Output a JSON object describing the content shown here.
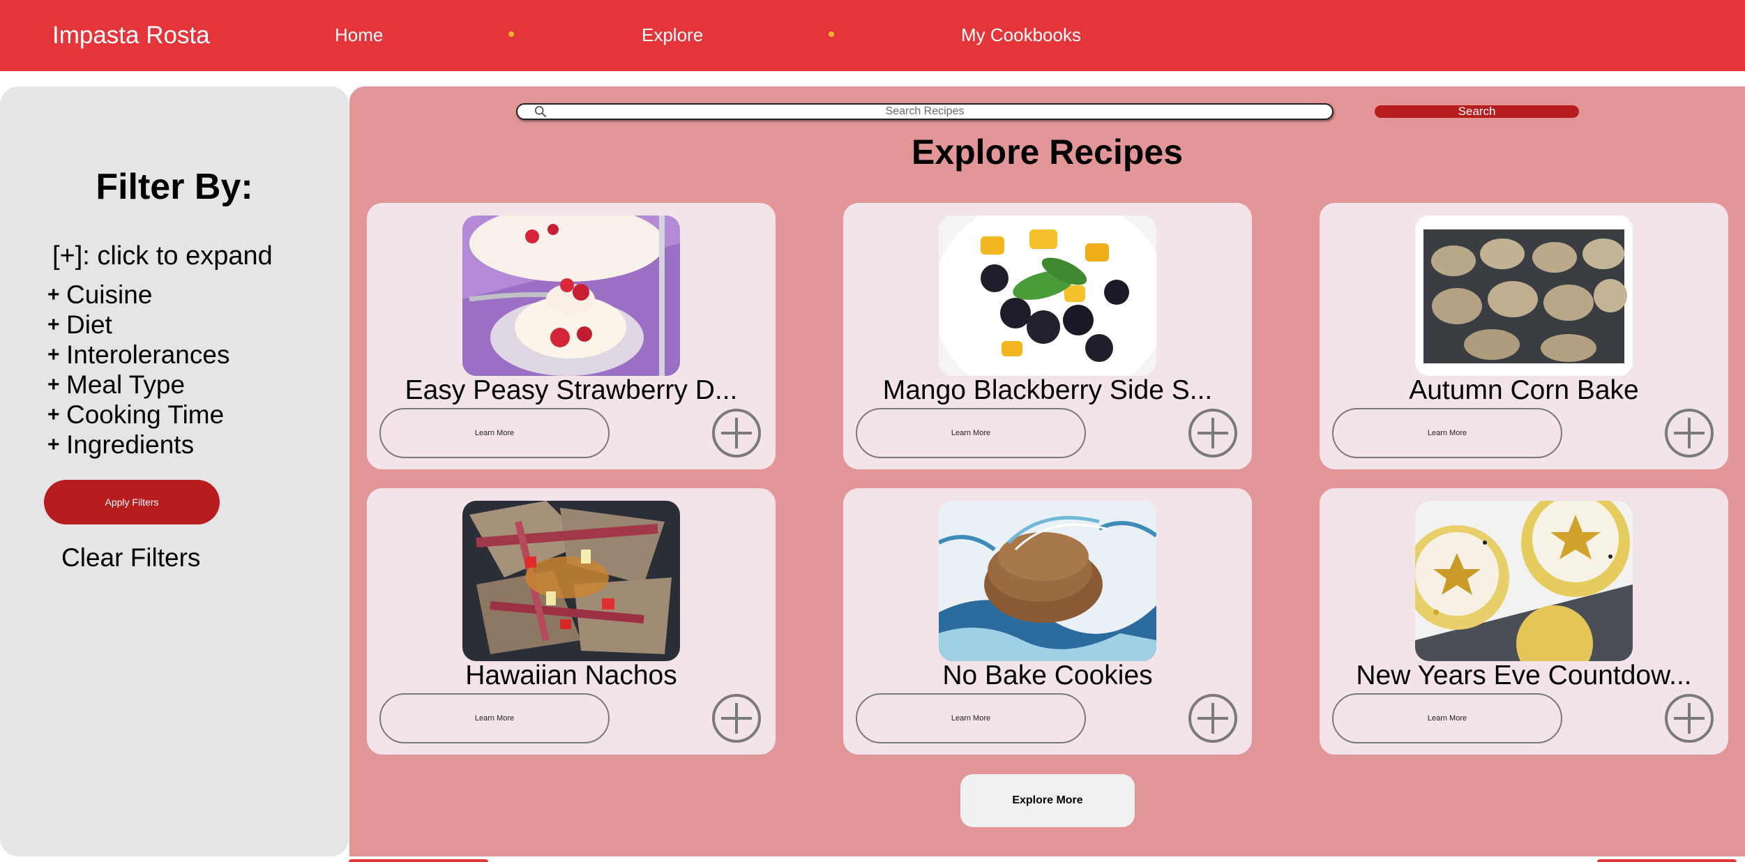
{
  "navbar": {
    "brand": "Impasta Rosta",
    "links": [
      {
        "label": "Home"
      },
      {
        "label": "Explore"
      },
      {
        "label": "My Cookbooks"
      }
    ],
    "dot_color": "#f0b429",
    "background": "#e4353b"
  },
  "sidebar": {
    "title": "Filter By:",
    "hint": "[+]: click to expand",
    "filters": [
      {
        "icon": "plus-icon",
        "label": "Cuisine"
      },
      {
        "icon": "plus-icon",
        "label": "Diet"
      },
      {
        "icon": "plus-icon",
        "label": "Interolerances"
      },
      {
        "icon": "plus-icon",
        "label": "Meal Type"
      },
      {
        "icon": "plus-icon",
        "label": "Cooking Time"
      },
      {
        "icon": "plus-icon",
        "label": "Ingredients"
      }
    ],
    "apply_label": "Apply Filters",
    "clear_label": "Clear Filters"
  },
  "search": {
    "placeholder": "Search Recipes",
    "value": "",
    "button_label": "Search",
    "icon": "search-icon"
  },
  "main": {
    "heading": "Explore Recipes",
    "explore_more_label": "Explore More",
    "accent_color": "#b71c1f"
  },
  "recipes": [
    {
      "title": "Easy Peasy Strawberry D...",
      "learn_more": "Learn More",
      "add_icon": "plus-circle-icon",
      "image": "strawberry-dessert-photo"
    },
    {
      "title": "Mango Blackberry Side S...",
      "learn_more": "Learn More",
      "add_icon": "plus-circle-icon",
      "image": "mango-blackberry-salad-photo"
    },
    {
      "title": "Autumn Corn Bake",
      "learn_more": "Learn More",
      "add_icon": "plus-circle-icon",
      "image": "corn-bake-biscuits-photo"
    },
    {
      "title": "Hawaiian Nachos",
      "learn_more": "Learn More",
      "add_icon": "plus-circle-icon",
      "image": "hawaiian-nachos-photo"
    },
    {
      "title": "No Bake Cookies",
      "learn_more": "Learn More",
      "add_icon": "plus-circle-icon",
      "image": "no-bake-cookies-photo"
    },
    {
      "title": "New Years Eve Countdow...",
      "learn_more": "Learn More",
      "add_icon": "plus-circle-icon",
      "image": "clock-cookies-photo"
    }
  ]
}
